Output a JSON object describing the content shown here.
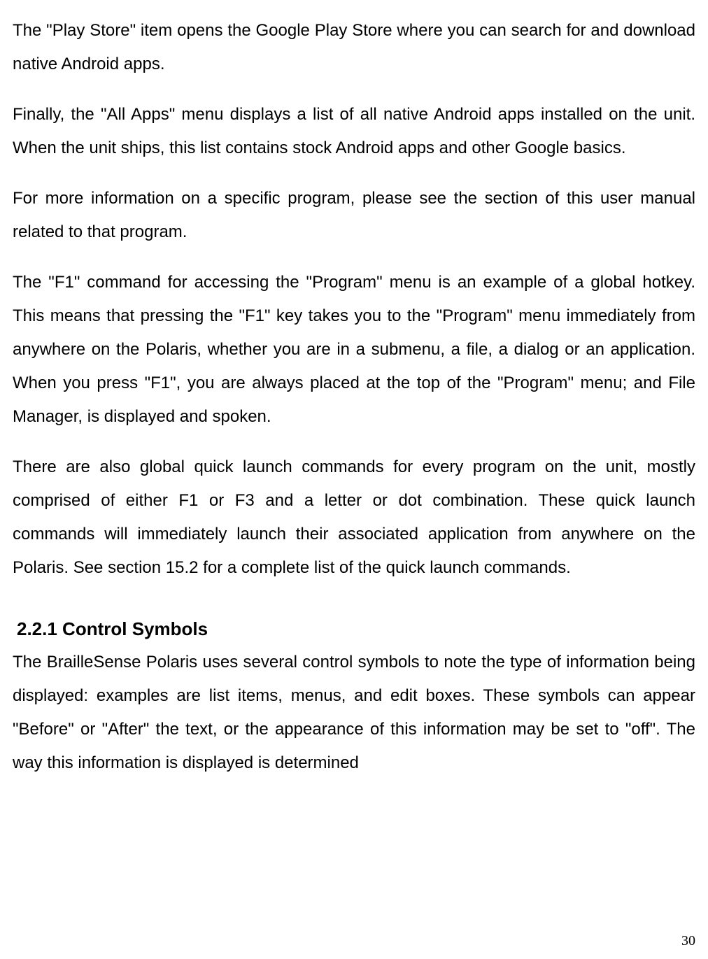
{
  "paragraphs": {
    "p1": "The \"Play Store\" item opens the Google Play Store where you can search for and download native Android apps.",
    "p2": "Finally, the \"All Apps\" menu displays a list of all native Android apps installed on the unit. When the unit ships, this list contains stock Android apps and other Google basics.",
    "p3": "For more information on a specific program, please see the section of this user manual related to that program.",
    "p4": "The \"F1\" command for accessing the \"Program\" menu is an example of a global hotkey. This means that pressing the \"F1\" key takes you to the \"Program\" menu immediately from anywhere on the Polaris, whether you are in a submenu, a file, a dialog or an application. When you press \"F1\", you are always placed at the top of the \"Program\" menu; and File Manager, is displayed and spoken.",
    "p5": "There are also global quick launch commands for every program on the unit, mostly comprised of either F1 or F3 and a letter or dot combination. These quick launch commands will immediately launch their associated application from anywhere on the Polaris. See section 15.2 for a complete list of the quick launch commands.",
    "p6": "The BrailleSense Polaris uses several control symbols to note the type of information being displayed: examples are list items, menus, and edit boxes. These symbols can appear \"Before\" or \"After\" the text, or the appearance of this information may be set to \"off\". The way this information is displayed is determined"
  },
  "heading": "2.2.1 Control Symbols",
  "pageNumber": "30"
}
